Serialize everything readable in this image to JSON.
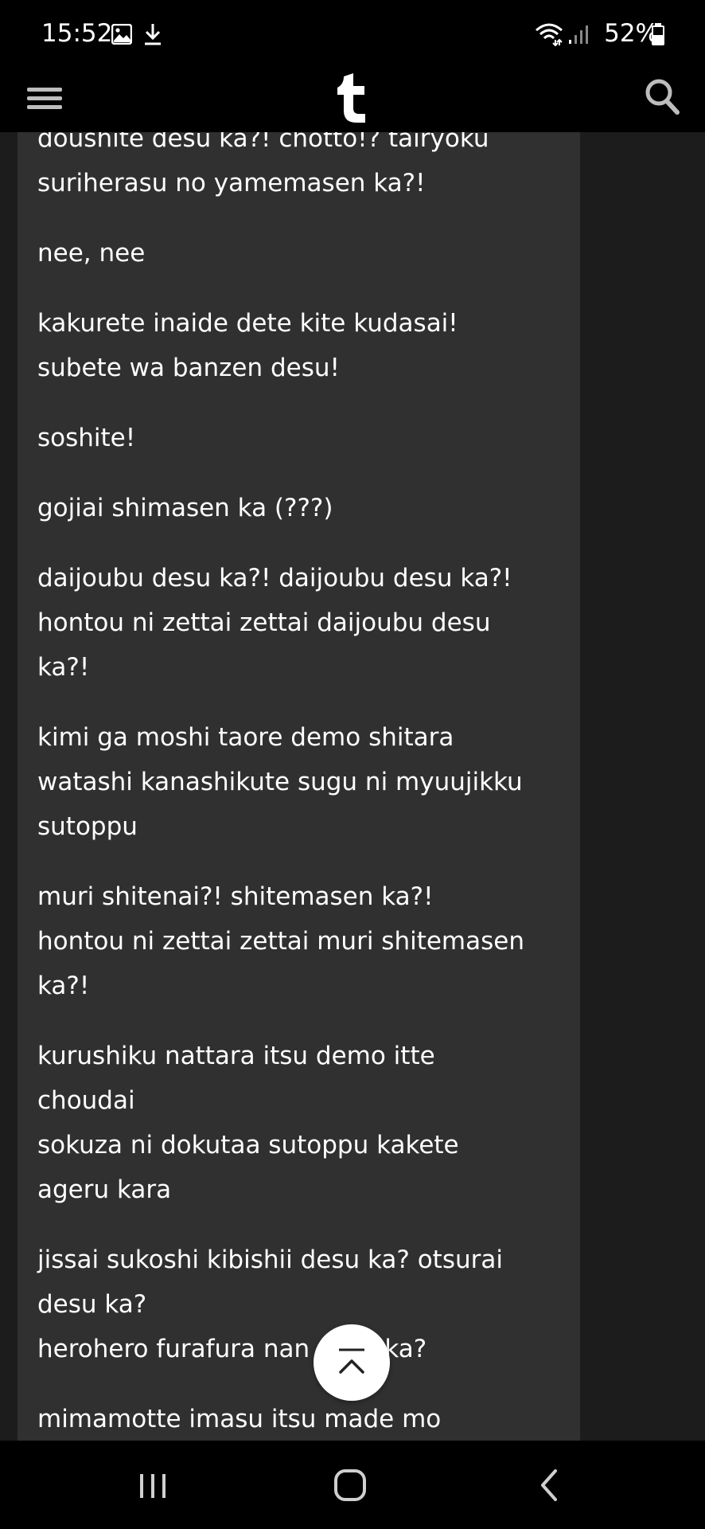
{
  "status_bar": {
    "time": "15:52",
    "battery": "52%",
    "icons": [
      "image-icon",
      "download-icon",
      "wifi-icon",
      "signal-icon",
      "battery-icon"
    ]
  },
  "app_bar": {
    "logo": "t",
    "menu_icon": "hamburger-menu-icon",
    "search_icon": "search-icon"
  },
  "post": {
    "paragraphs": [
      "doushite desu ka?! chotto!? tairyoku\nsuriherasu no yamemasen ka?!",
      "nee, nee",
      "kakurete inaide dete kite kudasai!\nsubete wa banzen desu!",
      "soshite!",
      "gojiai shimasen ka (???)",
      "daijoubu desu ka?! daijoubu desu ka?!\nhontou ni zettai zettai daijoubu desu\nka?!",
      "kimi ga moshi taore demo shitara\nwatashi kanashikute sugu ni myuujikku\nsutoppu",
      "muri shitenai?! shitemasen ka?!\nhontou ni zettai zettai muri shitemasen\nka?!",
      "kurushiku nattara itsu demo itte\nchoudai\nsokuza ni dokutaa sutoppu kakete\nageru kara",
      "jissai sukoshi kibishii desu ka? otsurai\ndesu ka?\nherohero furafura nan desu ka?",
      "mimamotte imasu itsu made mo"
    ]
  },
  "scroll_top": {
    "icon": "chevron-up-icon"
  },
  "nav_bar": {
    "icons": [
      "recent-apps-icon",
      "home-icon",
      "back-icon"
    ]
  },
  "colors": {
    "background": "#1c1c1c",
    "card": "#303030",
    "bars": "#000000",
    "text": "#ffffff"
  }
}
